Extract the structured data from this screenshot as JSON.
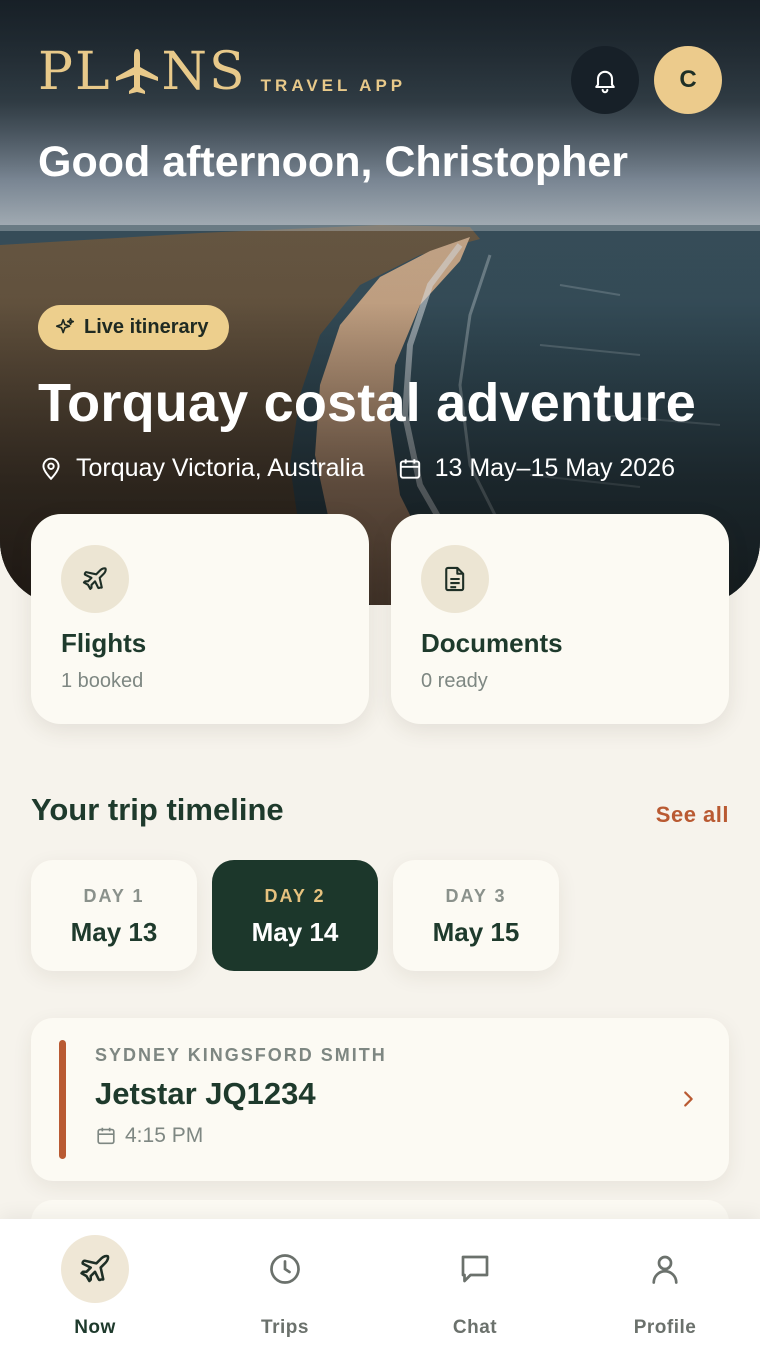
{
  "app": {
    "logo_left": "PL",
    "logo_right": "NS",
    "logo_subtitle": "TRAVEL APP",
    "avatar_initial": "C"
  },
  "header": {
    "greeting": "Good afternoon, Christopher"
  },
  "trip": {
    "badge": "Live itinerary",
    "title": "Torquay costal adventure",
    "location": "Torquay Victoria, Australia",
    "dates": "13 May–15 May 2026"
  },
  "summary_cards": [
    {
      "title": "Flights",
      "subtitle": "1 booked",
      "icon": "plane-icon"
    },
    {
      "title": "Documents",
      "subtitle": "0 ready",
      "icon": "document-icon"
    }
  ],
  "timeline": {
    "title": "Your trip timeline",
    "see_all": "See all",
    "days": [
      {
        "label": "DAY 1",
        "date": "May 13",
        "active": false
      },
      {
        "label": "DAY 2",
        "date": "May 14",
        "active": true
      },
      {
        "label": "DAY 3",
        "date": "May 15",
        "active": false
      }
    ],
    "events": [
      {
        "airport": "SYDNEY KINGSFORD SMITH",
        "flight": "Jetstar JQ1234",
        "time": "4:15 PM"
      }
    ]
  },
  "nav": {
    "items": [
      {
        "label": "Now",
        "icon": "plane-icon",
        "active": true
      },
      {
        "label": "Trips",
        "icon": "clock-icon",
        "active": false
      },
      {
        "label": "Chat",
        "icon": "chat-icon",
        "active": false
      },
      {
        "label": "Profile",
        "icon": "user-icon",
        "active": false
      }
    ]
  },
  "colors": {
    "accent_gold": "#eccb8c",
    "dark_green": "#1c372b",
    "terracotta": "#b95a32",
    "background": "#f6f3ec"
  }
}
